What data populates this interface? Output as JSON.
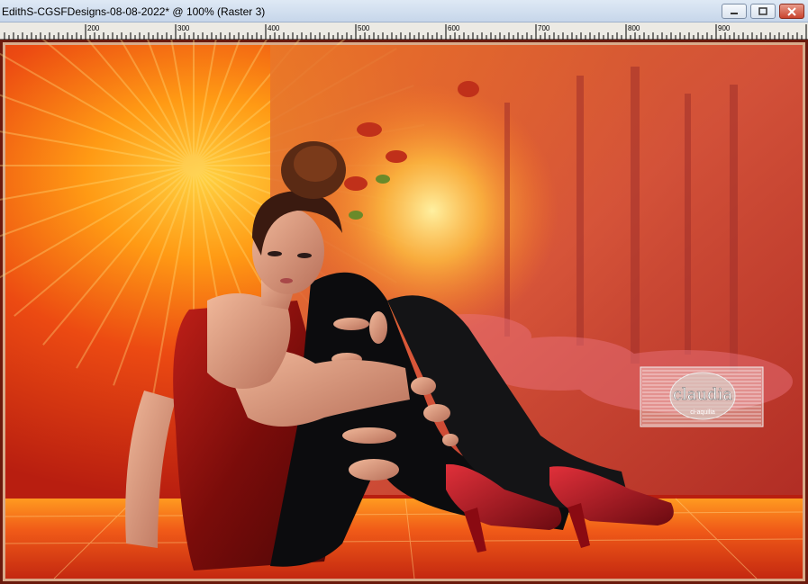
{
  "window": {
    "title": "EdithS-CGSFDesigns-08-08-2022* @ 100% (Raster 3)",
    "controls": [
      "minimize",
      "maximize",
      "close"
    ]
  },
  "ruler": {
    "labels": [
      "200",
      "300",
      "400",
      "500",
      "600",
      "700",
      "800",
      "900"
    ]
  },
  "canvas": {
    "watermark": {
      "text": "claudia",
      "subtext": "ci-aquilia"
    }
  },
  "colors": {
    "accent": "#e0401a",
    "frame": "#6b1a0d",
    "glow": "#ffb020"
  }
}
